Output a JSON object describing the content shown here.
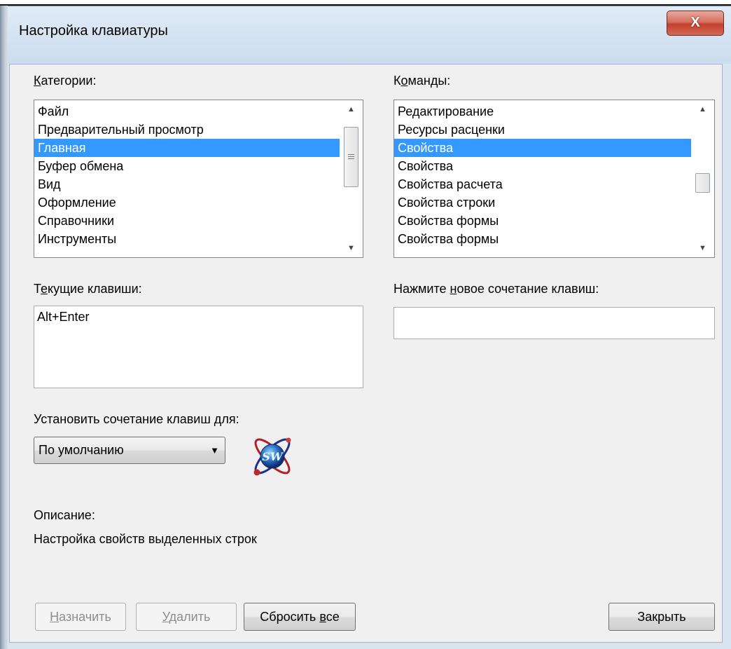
{
  "window": {
    "title": "Настройка клавиатуры",
    "close_glyph": "X"
  },
  "categories": {
    "label": "Категории:",
    "items": [
      "Файл",
      "Предварительный просмотр",
      "Главная",
      "Буфер обмена",
      "Вид",
      "Оформление",
      "Справочники",
      "Инструменты"
    ],
    "selected": "Главная"
  },
  "commands": {
    "label": "Команды:",
    "items": [
      "Редактирование",
      "Ресурсы расценки",
      "Свойства",
      "Свойства",
      "Свойства расчета",
      "Свойства строки",
      "Свойства формы",
      "Свойства формы"
    ],
    "selected_index": 2
  },
  "current_keys": {
    "label": "Текущие клавиши:",
    "value": "Alt+Enter"
  },
  "new_shortcut": {
    "label": "Нажмите новое сочетание клавиш:",
    "value": ""
  },
  "set_for": {
    "label": "Установить сочетание клавиш для:",
    "selected": "По умолчанию",
    "logo_icon": "sw-atom-logo-icon"
  },
  "description": {
    "label": "Описание:",
    "text": "Настройка свойств выделенных строк"
  },
  "buttons": {
    "assign": "Назначить",
    "delete": "Удалить",
    "reset_all": "Сбросить все",
    "close": "Закрыть"
  },
  "colors": {
    "selection": "#3399ff",
    "close_button": "#c4412e",
    "titlebar": "#d4e2f1"
  }
}
